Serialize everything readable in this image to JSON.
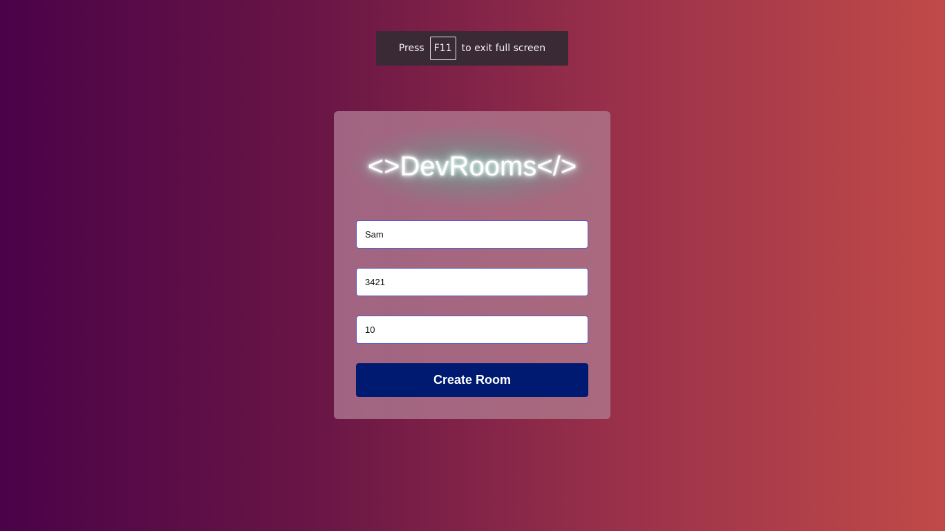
{
  "fullscreen_notice": {
    "prefix": "Press",
    "key": "F11",
    "suffix": "to exit full screen"
  },
  "card": {
    "logo": "<>DevRooms</>",
    "fields": [
      {
        "value": "Sam"
      },
      {
        "value": "3421"
      },
      {
        "value": "10"
      }
    ],
    "create_button_label": "Create Room"
  }
}
